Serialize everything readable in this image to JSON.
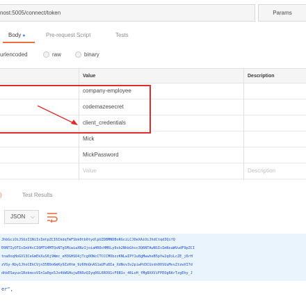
{
  "request": {
    "url": "nost:5005/connect/token",
    "params_label": "Params"
  },
  "tabs": [
    {
      "label": "Body"
    },
    {
      "label": "Pre-request Script"
    },
    {
      "label": "Tests"
    }
  ],
  "body_types": [
    {
      "label": "urlencoded"
    },
    {
      "label": "raw"
    },
    {
      "label": "binary"
    }
  ],
  "table": {
    "headers": {
      "value": "Value",
      "description": "Description"
    },
    "rows": [
      {
        "value": "company-employee"
      },
      {
        "value": "codemazesecret"
      },
      {
        "value": "client_credentials"
      },
      {
        "value": "Mick"
      },
      {
        "value": "MickPassword"
      }
    ],
    "placeholder_value": "Value",
    "placeholder_description": "Description"
  },
  "response_tabs": [
    {
      "label": ")"
    },
    {
      "label": "Test Results"
    }
  ],
  "format": {
    "selected": "JSON"
  },
  "code_lines": [
    "JhbGciOiJSUzI1NiIsImtpZCI6IkdqTmFSbk0tb0tydlpUZDBMNDBoRGciLCJ0eXAiOiJhdCtqd3QifQ",
    "E0NTIyOTIsImV4cCI6MTU4MTQxNTgSMiwiaXNzIjoiaHR0cHM6Ly9sb2NhbGhvc3Q6NTAwNSIsImNsaWVudF9pZCI",
    "tna0oqHoGV13CeGmEkXuS6j9Wmc_eH3GHSO4jTcg0OWcCTCCCMObzzKNLwIPY1u8gMwwheB5pYw2q0iLcZE_j6rH",
    "zVSy-Rby1JhoCEkCVjn35B9o6mKy9ZzHtm_9z6HnQnAS1aUFu8Ia_XdNvv3v2piwPd3CUsdn0OSUuMvvZtzwVI7d",
    "dhbESayux1RokmsxVIn1a0gx5Jx4bWGHujwEN9zQIyq06L6RO91cF6B1s_46LoH_fMgBXXViFPEOgRArTzgEhy_J"
  ],
  "tail": {
    "value": "er\"",
    "comma": ","
  }
}
